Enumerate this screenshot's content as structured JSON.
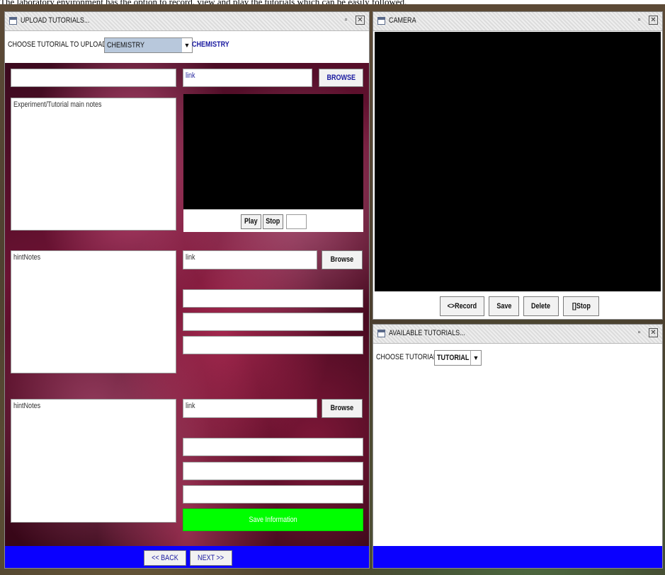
{
  "caption": "The laboratory environment has the option to record, view and play the tutorials which can be easily followed.",
  "upload_window": {
    "title": "UPLOAD TUTORIALS...",
    "choose_label": "CHOOSE TUTORIAL TO UPLOAD",
    "subject_selected": "CHEMISTRY",
    "subject_display": "CHEMISTRY",
    "title_field_value": "",
    "main_link_placeholder": "link",
    "browse_label": "BROWSE",
    "main_notes_placeholder": "Experiment/Tutorial main notes",
    "play_label": "Play",
    "stop_label": "Stop",
    "counter_value": "",
    "hint1_placeholder": "hintNotes",
    "hint1_link_placeholder": "link",
    "hint1_browse_label": "Browse",
    "hint2_placeholder": "hintNotes",
    "hint2_link_placeholder": "link",
    "hint2_browse_label": "Browse",
    "save_label": "Save Information",
    "back_label": "<< BACK",
    "next_label": "NEXT >>"
  },
  "camera_window": {
    "title": "CAMERA",
    "record_label": "<>Record",
    "save_label": "Save",
    "delete_label": "Delete",
    "stop_label": "[]Stop"
  },
  "tutorials_window": {
    "title": "AVAILABLE TUTORIALS...",
    "choose_label": "CHOOSE TUTORIAL",
    "selected": "TUTORIAL"
  },
  "colors": {
    "bottom_bar": "#0a00ff",
    "save_button": "#00ff00",
    "accent_text": "#1a1aa0"
  }
}
